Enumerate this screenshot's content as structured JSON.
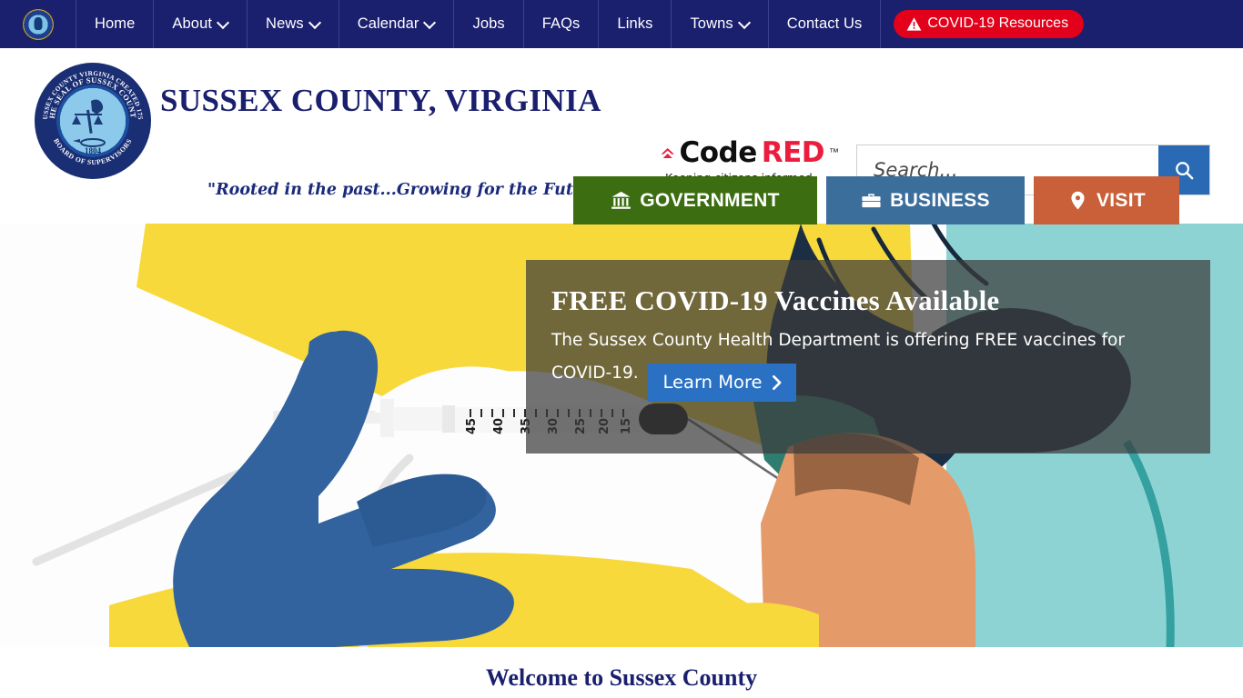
{
  "topnav": {
    "logo_alt": "Sussex County seal",
    "items": [
      {
        "label": "Home",
        "has_dropdown": false
      },
      {
        "label": "About",
        "has_dropdown": true
      },
      {
        "label": "News",
        "has_dropdown": true
      },
      {
        "label": "Calendar",
        "has_dropdown": true
      },
      {
        "label": "Jobs",
        "has_dropdown": false
      },
      {
        "label": "FAQs",
        "has_dropdown": false
      },
      {
        "label": "Links",
        "has_dropdown": false
      },
      {
        "label": "Towns",
        "has_dropdown": true
      },
      {
        "label": "Contact Us",
        "has_dropdown": false
      }
    ],
    "covid_button": {
      "label": "COVID-19 Resources",
      "icon": "warning-triangle-icon",
      "background": "#e2001a",
      "text_color": "#ffffff"
    },
    "background": "#1a1f6e"
  },
  "header": {
    "title": "SUSSEX COUNTY, VIRGINIA",
    "tagline": "\"Rooted in the past...Growing for the Future!\"",
    "title_color": "#1a1f6e",
    "seal": {
      "outer_text_top": "SUSSEX COUNTY VIRGINIA CREATED 1754",
      "inner_text_top": "THE SEAL OF SUSSEX COUNTY",
      "year": "1804",
      "outer_text_bottom": "BOARD OF SUPERVISORS"
    },
    "codered": {
      "word_1": "Code",
      "word_2": "RED",
      "trademark": "™",
      "tagline": "Keeping citizens informed.",
      "word_1_color": "#0f0f0f",
      "word_2_color": "#ec1c3d",
      "icon": "codered-triangle-icon"
    },
    "search": {
      "placeholder": "Search...",
      "value": "",
      "button_icon": "search-icon",
      "button_color": "#2a6ab5"
    }
  },
  "category_tabs": [
    {
      "label": "GOVERNMENT",
      "icon": "bank-icon",
      "color": "#3c6d10"
    },
    {
      "label": "BUSINESS",
      "icon": "briefcase-icon",
      "color": "#3c6e9c"
    },
    {
      "label": "VISIT",
      "icon": "map-pin-icon",
      "color": "#c9603a"
    }
  ],
  "hero": {
    "image_alt": "Illustration of a gloved hand administering a vaccine injection into an arm",
    "title": "FREE COVID-19 Vaccines Available",
    "subtitle": "The Sussex County Health Department is offering FREE vaccines for",
    "subtitle_cont": "COVID-19.",
    "cta_label": "Learn More",
    "cta_icon": "chevron-right-icon",
    "cta_color": "#2a71c4",
    "overlay_color": "rgba(60,60,60,0.72)",
    "palette": {
      "teal_bg": "#8ed3d4",
      "yellow": "#f7d93c",
      "glove_blue": "#33639e",
      "glove_navy": "#1c2e44",
      "skin": "#e59a6a",
      "white": "#fdfdfd"
    }
  },
  "welcome": {
    "heading": "Welcome to Sussex County"
  }
}
